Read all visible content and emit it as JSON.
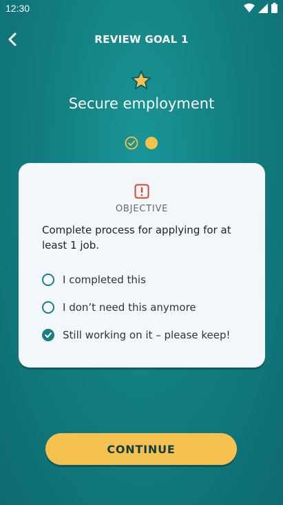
{
  "status_bar": {
    "time": "12:30"
  },
  "header": {
    "title": "REVIEW GOAL 1"
  },
  "goal": {
    "title": "Secure employment"
  },
  "progress": {
    "completed_steps": 1,
    "current_step": 2,
    "total_steps": 2
  },
  "card": {
    "label": "OBJECTIVE",
    "text": "Complete process for applying for at least 1 job.",
    "options": [
      {
        "label": "I completed this",
        "selected": false
      },
      {
        "label": "I don’t need this anymore",
        "selected": false
      },
      {
        "label": "Still working on it – please keep!",
        "selected": true
      }
    ]
  },
  "continue_label": "CONTINUE",
  "colors": {
    "background": "#137f82",
    "accent": "#f5c14f",
    "radio": "#1b7e82",
    "alert": "#d9452b"
  }
}
